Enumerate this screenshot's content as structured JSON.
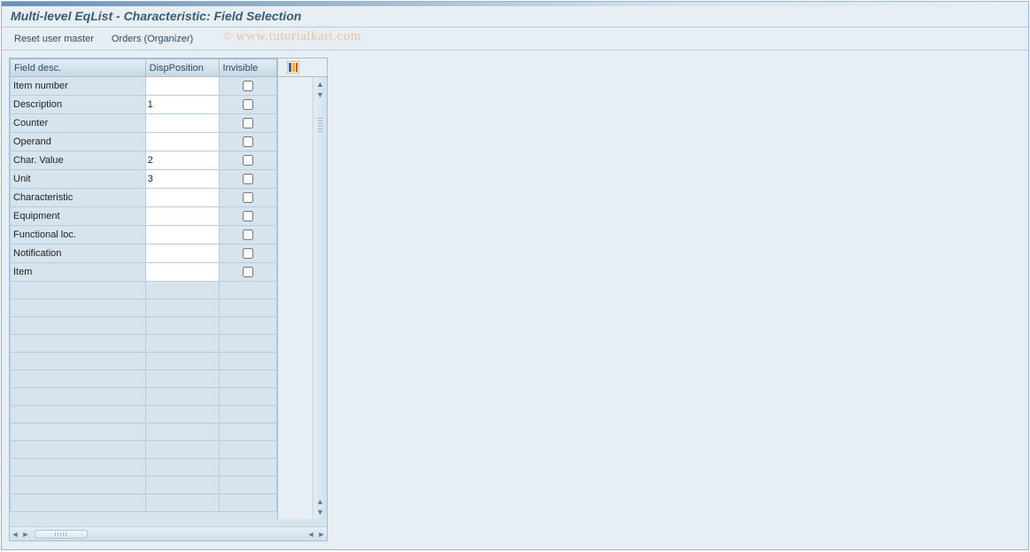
{
  "title": "Multi-level EqList - Characteristic: Field Selection",
  "toolbar": {
    "reset_label": "Reset user master",
    "orders_label": "Orders (Organizer)"
  },
  "watermark": "www.tutorialkart.com",
  "table": {
    "headers": {
      "field_desc": "Field desc.",
      "disp_position": "DispPosition",
      "invisible": "Invisible"
    },
    "rows": [
      {
        "field": "Item number",
        "pos": "",
        "invisible": false
      },
      {
        "field": "Description",
        "pos": "1",
        "invisible": false
      },
      {
        "field": "Counter",
        "pos": "",
        "invisible": false
      },
      {
        "field": "Operand",
        "pos": "",
        "invisible": false
      },
      {
        "field": "Char. Value",
        "pos": "2",
        "invisible": false
      },
      {
        "field": "Unit",
        "pos": "3",
        "invisible": false
      },
      {
        "field": "Characteristic",
        "pos": "",
        "invisible": false
      },
      {
        "field": "Equipment",
        "pos": "",
        "invisible": false
      },
      {
        "field": "Functional loc.",
        "pos": "",
        "invisible": false
      },
      {
        "field": "Notification",
        "pos": "",
        "invisible": false
      },
      {
        "field": "Item",
        "pos": "",
        "invisible": false
      }
    ],
    "empty_row_count": 13
  },
  "icons": {
    "settings": "table-settings-icon"
  }
}
